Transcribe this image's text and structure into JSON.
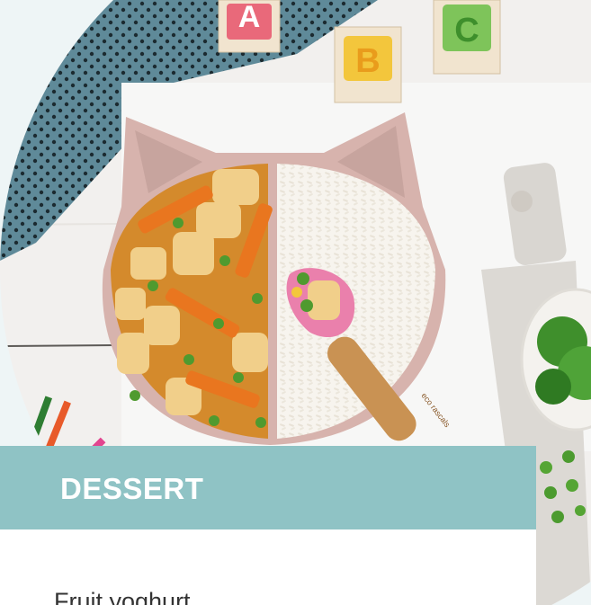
{
  "section": {
    "title": "DESSERT"
  },
  "menu": {
    "items": [
      "Fruit yoghurt"
    ]
  },
  "photo": {
    "blocks": [
      "A",
      "B",
      "C"
    ],
    "spoon_brand": "eco rascals"
  },
  "colors": {
    "banner": "#8fc3c5",
    "page_background": "#eef5f6",
    "plate": "#d7b3ad",
    "curry": "#d48a2c",
    "carrot": "#e9761f",
    "peas": "#4f9a2f",
    "rice": "#f7f4ee"
  }
}
